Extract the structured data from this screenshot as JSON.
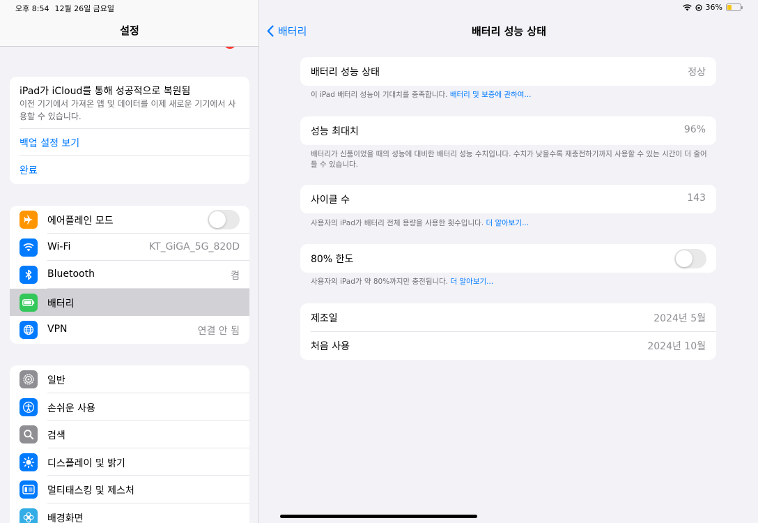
{
  "status_bar": {
    "time": "오후 8:54",
    "date": "12월 26일 금요일",
    "battery_pct": "36%",
    "battery_level": 0.36
  },
  "sidebar": {
    "title": "설정",
    "restore": {
      "title": "iPad가 iCloud를 통해 성공적으로 복원됨",
      "description": "이전 기기에서 가져온 앱 및 데이터를 이제 새로운 기기에서 사용할 수 있습니다.",
      "backup_link": "백업 설정 보기",
      "done_link": "완료"
    },
    "connectivity": [
      {
        "label": "에어플레인 모드",
        "icon": "airplane-icon",
        "color": "#ff9500",
        "toggle": false
      },
      {
        "label": "Wi-Fi",
        "value": "KT_GiGA_5G_820D",
        "icon": "wifi-icon",
        "color": "#007aff"
      },
      {
        "label": "Bluetooth",
        "value": "켬",
        "icon": "bluetooth-icon",
        "color": "#007aff"
      },
      {
        "label": "배터리",
        "icon": "battery-icon",
        "color": "#34c759",
        "selected": true
      },
      {
        "label": "VPN",
        "value": "연결 안 됨",
        "icon": "globe-icon",
        "color": "#007aff"
      }
    ],
    "general": [
      {
        "label": "일반",
        "icon": "gear-icon",
        "color": "#8e8e93"
      },
      {
        "label": "손쉬운 사용",
        "icon": "accessibility-icon",
        "color": "#007aff"
      },
      {
        "label": "검색",
        "icon": "search-icon",
        "color": "#8e8e93"
      },
      {
        "label": "디스플레이 및 밝기",
        "icon": "sun-icon",
        "color": "#007aff"
      },
      {
        "label": "멀티태스킹 및 제스처",
        "icon": "multitasking-icon",
        "color": "#007aff"
      },
      {
        "label": "배경화면",
        "icon": "flower-icon",
        "color": "#32ade6"
      }
    ]
  },
  "detail": {
    "back_label": "배터리",
    "title": "배터리 성능 상태",
    "health": {
      "label": "배터리 성능 상태",
      "value": "정상",
      "footer": "이 iPad 배터리 성능이 기대치를 충족합니다.",
      "footer_link": "배터리 및 보증에 관하여..."
    },
    "max_capacity": {
      "label": "성능 최대치",
      "value": "96%",
      "footer": "배터리가 신품이었을 때의 성능에 대비한 배터리 성능 수치입니다. 수치가 낮을수록 재충전하기까지 사용할 수 있는 시간이 더 줄어들 수 있습니다."
    },
    "cycle_count": {
      "label": "사이클 수",
      "value": "143",
      "footer": "사용자의 iPad가 배터리 전체 용량을 사용한 횟수입니다.",
      "footer_link": "더 알아보기..."
    },
    "limit_80": {
      "label": "80% 한도",
      "toggle": false,
      "footer": "사용자의 iPad가 약 80%까지만 충전됩니다.",
      "footer_link": "더 알아보기..."
    },
    "manufacture": {
      "label": "제조일",
      "value": "2024년 5월"
    },
    "first_use": {
      "label": "처음 사용",
      "value": "2024년 10월"
    }
  }
}
